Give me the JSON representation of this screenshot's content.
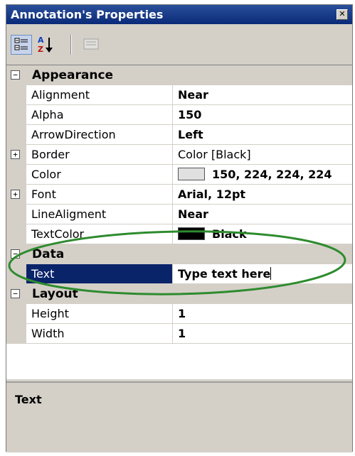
{
  "window": {
    "title": "Annotation's Properties"
  },
  "toolbar": {
    "buttons": [
      {
        "name": "categorized-icon"
      },
      {
        "name": "alphabetical-icon"
      },
      {
        "name": "property-pages-icon"
      }
    ]
  },
  "categories": {
    "appearance": {
      "label": "Appearance",
      "expander": "−",
      "rows": [
        {
          "name": "Alignment",
          "value": "Near"
        },
        {
          "name": "Alpha",
          "value": "150"
        },
        {
          "name": "ArrowDirection",
          "value": "Left"
        },
        {
          "name": "Border",
          "value": "Color [Black]",
          "expander": "+"
        },
        {
          "name": "Color",
          "value": "150, 224, 224, 224",
          "swatch": "#e0e0e0"
        },
        {
          "name": "Font",
          "value": "Arial, 12pt",
          "expander": "+"
        },
        {
          "name": "LineAligment",
          "value": "Near"
        },
        {
          "name": "TextColor",
          "value": "Black",
          "swatch": "#000000"
        }
      ]
    },
    "data": {
      "label": "Data",
      "expander": "−",
      "rows": [
        {
          "name": "Text",
          "value": "Type text here"
        }
      ]
    },
    "layout": {
      "label": "Layout",
      "expander": "−",
      "rows": [
        {
          "name": "Height",
          "value": "1"
        },
        {
          "name": "Width",
          "value": "1"
        }
      ]
    }
  },
  "help": {
    "title": "Text"
  },
  "colors": {
    "titlebar": "#0a2a78",
    "selection": "#0a246a",
    "highlight_ellipse": "#2e8b2e"
  }
}
